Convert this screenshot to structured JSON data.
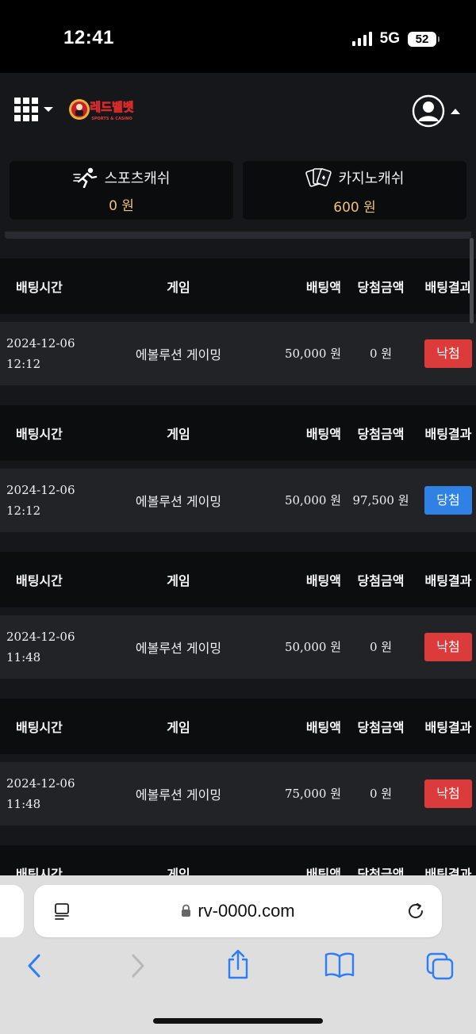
{
  "status_bar": {
    "time": "12:41",
    "network": "5G",
    "battery": "52"
  },
  "header": {
    "logo_text": "레드벨벳",
    "logo_sub": "SPORTS & CASINO"
  },
  "wallets": [
    {
      "title": "스포츠캐쉬",
      "amount": "0 원",
      "icon": "runner-icon"
    },
    {
      "title": "카지노캐쉬",
      "amount": "600 원",
      "icon": "cards-icon"
    }
  ],
  "columns": {
    "time": "배팅시간",
    "game": "게임",
    "bet": "배팅액",
    "win": "당첨금액",
    "result": "배팅결과"
  },
  "bets": [
    {
      "date": "2024-12-06",
      "time": "12:12",
      "game": "에볼루션 게이밍",
      "bet": "50,000 원",
      "win": "0 원",
      "result": "낙첨",
      "status": "lose"
    },
    {
      "date": "2024-12-06",
      "time": "12:12",
      "game": "에볼루션 게이밍",
      "bet": "50,000 원",
      "win": "97,500 원",
      "result": "당첨",
      "status": "win"
    },
    {
      "date": "2024-12-06",
      "time": "11:48",
      "game": "에볼루션 게이밍",
      "bet": "50,000 원",
      "win": "0 원",
      "result": "낙첨",
      "status": "lose"
    },
    {
      "date": "2024-12-06",
      "time": "11:48",
      "game": "에볼루션 게이밍",
      "bet": "75,000 원",
      "win": "0 원",
      "result": "낙첨",
      "status": "lose"
    }
  ],
  "browser": {
    "url": "rv-0000.com"
  },
  "colors": {
    "win": "#2f82e4",
    "lose": "#dc3b3b",
    "amount": "#f0c074"
  }
}
